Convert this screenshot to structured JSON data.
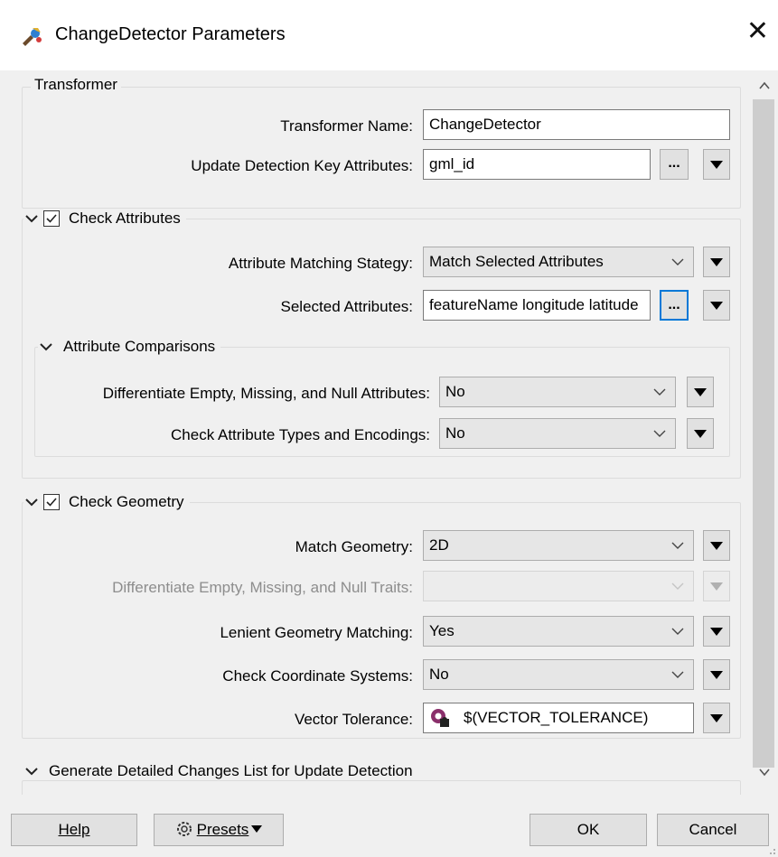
{
  "window": {
    "title": "ChangeDetector Parameters",
    "close_glyph": "✕",
    "app_icon": "fme-transformer-icon"
  },
  "transformer": {
    "group_title": "Transformer",
    "name_label": "Transformer Name:",
    "name_value": "ChangeDetector",
    "key_label": "Update Detection Key Attributes:",
    "key_value": "gml_id",
    "ellipsis": "..."
  },
  "check_attributes": {
    "title": "Check Attributes",
    "checked": true,
    "matching_label": "Attribute Matching Stategy:",
    "matching_value": "Match Selected Attributes",
    "selected_label": "Selected Attributes:",
    "selected_value": "featureName longitude latitude",
    "ellipsis": "...",
    "comparisons": {
      "title": "Attribute Comparisons",
      "diff_label": "Differentiate Empty, Missing, and Null Attributes:",
      "diff_value": "No",
      "types_label": "Check Attribute Types and Encodings:",
      "types_value": "No"
    }
  },
  "check_geometry": {
    "title": "Check Geometry",
    "checked": true,
    "match_label": "Match Geometry:",
    "match_value": "2D",
    "traits_label": "Differentiate Empty, Missing, and Null Traits:",
    "traits_value": "",
    "lenient_label": "Lenient Geometry Matching:",
    "lenient_value": "Yes",
    "coord_label": "Check Coordinate Systems:",
    "coord_value": "No",
    "tolerance_label": "Vector Tolerance:",
    "tolerance_value": "$(VECTOR_TOLERANCE)"
  },
  "detailed_changes": {
    "title": "Generate Detailed Changes List for Update Detection"
  },
  "footer": {
    "help_label": "Help",
    "presets_label": "Presets",
    "ok_label": "OK",
    "cancel_label": "Cancel"
  }
}
